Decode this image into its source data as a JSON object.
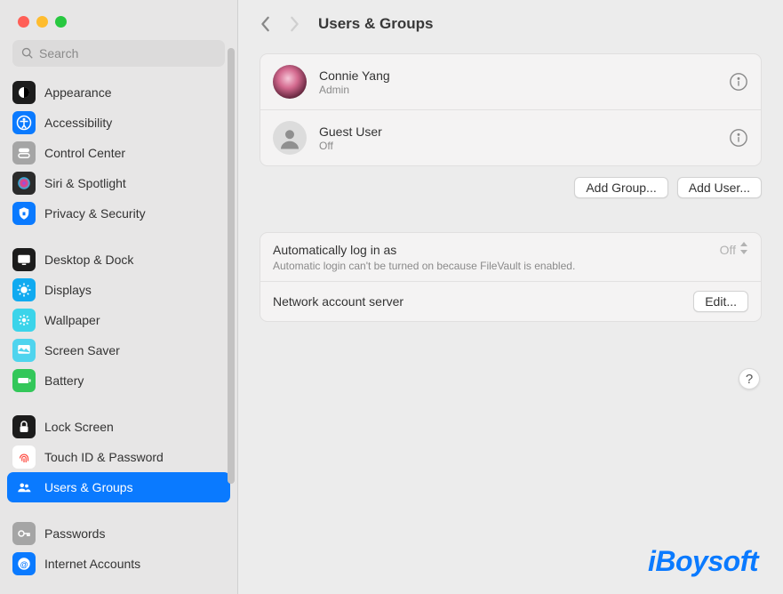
{
  "window": {
    "title": "Users & Groups"
  },
  "search": {
    "placeholder": "Search"
  },
  "sidebar": {
    "items": [
      {
        "label": "Appearance",
        "icon": "appearance",
        "bg": "#1c1c1c",
        "fg": "#ffffff"
      },
      {
        "label": "Accessibility",
        "icon": "accessibility",
        "bg": "#0a7aff",
        "fg": "#ffffff"
      },
      {
        "label": "Control Center",
        "icon": "control-center",
        "bg": "#a5a5a5",
        "fg": "#ffffff"
      },
      {
        "label": "Siri & Spotlight",
        "icon": "siri",
        "bg": "#2b2b2b",
        "fg": "#ffffff"
      },
      {
        "label": "Privacy & Security",
        "icon": "privacy",
        "bg": "#0a7aff",
        "fg": "#ffffff"
      },
      {
        "label": "Desktop & Dock",
        "icon": "desktop",
        "bg": "#1c1c1c",
        "fg": "#ffffff"
      },
      {
        "label": "Displays",
        "icon": "displays",
        "bg": "#10aaf0",
        "fg": "#ffffff"
      },
      {
        "label": "Wallpaper",
        "icon": "wallpaper",
        "bg": "#3bd4ea",
        "fg": "#ffffff"
      },
      {
        "label": "Screen Saver",
        "icon": "screensaver",
        "bg": "#4fd4ee",
        "fg": "#ffffff"
      },
      {
        "label": "Battery",
        "icon": "battery",
        "bg": "#33c759",
        "fg": "#ffffff"
      },
      {
        "label": "Lock Screen",
        "icon": "lock",
        "bg": "#1c1c1c",
        "fg": "#ffffff"
      },
      {
        "label": "Touch ID & Password",
        "icon": "touchid",
        "bg": "#ffffff",
        "fg": "#ff3b30"
      },
      {
        "label": "Users & Groups",
        "icon": "users",
        "bg": "#0a7aff",
        "fg": "#ffffff",
        "selected": true
      },
      {
        "label": "Passwords",
        "icon": "passwords",
        "bg": "#a5a5a5",
        "fg": "#ffffff"
      },
      {
        "label": "Internet Accounts",
        "icon": "internet",
        "bg": "#0a7aff",
        "fg": "#ffffff"
      }
    ]
  },
  "users": [
    {
      "name": "Connie Yang",
      "role": "Admin",
      "avatar": "photo"
    },
    {
      "name": "Guest User",
      "role": "Off",
      "avatar": "guest"
    }
  ],
  "buttons": {
    "add_group": "Add Group...",
    "add_user": "Add User...",
    "edit": "Edit..."
  },
  "settings": {
    "auto_login": {
      "title": "Automatically log in as",
      "value": "Off",
      "note": "Automatic login can't be turned on because FileVault is enabled."
    },
    "network_server": {
      "title": "Network account server"
    }
  },
  "help": "?",
  "watermark": "iBoysoft"
}
